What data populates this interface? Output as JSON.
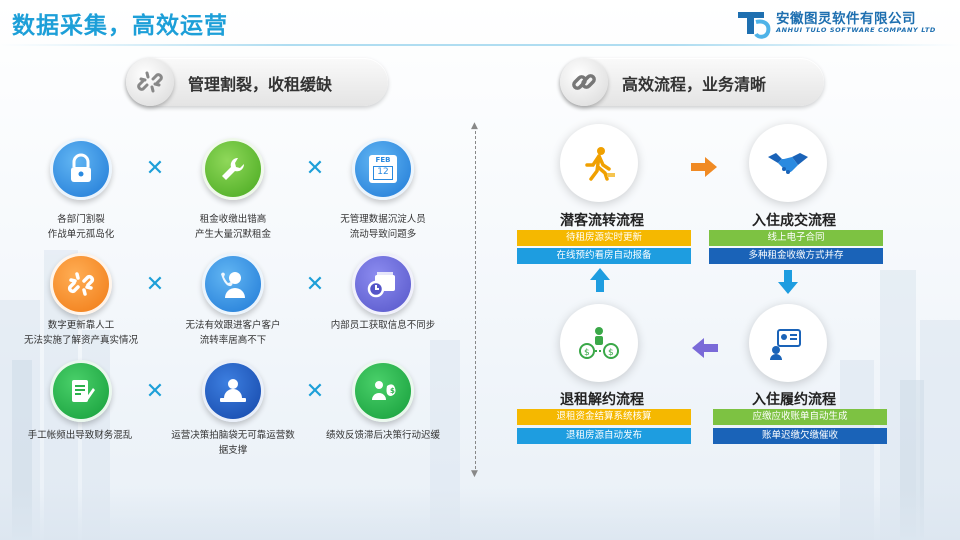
{
  "header": {
    "title": "数据采集，高效运营",
    "company_cn": "安徽图灵软件有限公司",
    "company_en": "ANHUI TULO SOFTWARE COMPANY LTD"
  },
  "left_section": {
    "heading": "管理割裂，收租缓缺",
    "problems": [
      {
        "label": "各部门割裂\n作战单元孤岛化",
        "icon": "lock-icon",
        "color": "#2a8ae0"
      },
      {
        "label": "租金收缴出错高\n产生大量沉默租金",
        "icon": "wrench-icon",
        "color": "#5bb52a"
      },
      {
        "label": "无管理数据沉淀人员\n流动导致问题多",
        "icon": "calendar-icon",
        "color": "#1e88e5",
        "calendar_month": "FEB",
        "calendar_day": "12"
      },
      {
        "label": "数字更新靠人工\n无法实施了解资产真实情况",
        "icon": "broken-link-icon",
        "color": "#f58a20"
      },
      {
        "label": "无法有效跟进客户客户\n流转率居高不下",
        "icon": "phone-person-icon",
        "color": "#2a8ae0"
      },
      {
        "label": "内部员工获取信息不同步",
        "icon": "folder-clock-icon",
        "color": "#6666d8"
      },
      {
        "label": "手工帐频出导致财务混乱",
        "icon": "document-edit-icon",
        "color": "#2db14c"
      },
      {
        "label": "运营决策拍脑袋无可靠运营数据支撑",
        "icon": "presenter-icon",
        "color": "#1b5fc8"
      },
      {
        "label": "绩效反馈滞后决策行动迟缓",
        "icon": "money-bag-icon",
        "color": "#2db14c"
      }
    ]
  },
  "right_section": {
    "heading": "高效流程，业务清晰",
    "steps": [
      {
        "title": "潜客流转流程",
        "icon": "running-person-icon",
        "bars": [
          {
            "text": "待租房源实时更新",
            "color": "#f5b800"
          },
          {
            "text": "在线预约看房自动报备",
            "color": "#1e9de0"
          }
        ]
      },
      {
        "title": "入住成交流程",
        "icon": "handshake-icon",
        "bars": [
          {
            "text": "线上电子合同",
            "color": "#7dc242"
          },
          {
            "text": "多种租金收缴方式并存",
            "color": "#1a63b8"
          }
        ]
      },
      {
        "title": "退租解约流程",
        "icon": "money-flow-icon",
        "bars": [
          {
            "text": "退租资金结算系统核算",
            "color": "#f5b800"
          },
          {
            "text": "退租房源自动发布",
            "color": "#1e9de0"
          }
        ]
      },
      {
        "title": "入住履约流程",
        "icon": "id-card-icon",
        "bars": [
          {
            "text": "应缴应收账单自动生成",
            "color": "#7dc242"
          },
          {
            "text": "账单迟缴欠缴催收",
            "color": "#1a63b8"
          }
        ]
      }
    ],
    "arrow_colors": {
      "right": "#f08a24",
      "down": "#1e9de0",
      "left": "#7a6ad8",
      "up": "#1e9de0"
    }
  }
}
